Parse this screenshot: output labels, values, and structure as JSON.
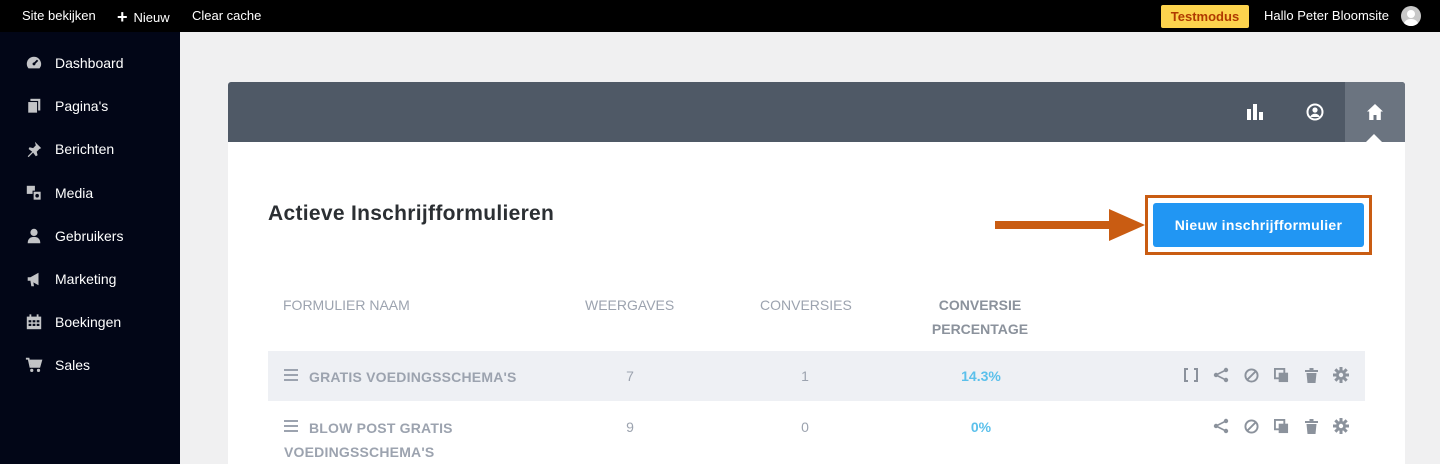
{
  "adminbar": {
    "site_view": "Site bekijken",
    "new_label": "Nieuw",
    "clear_cache": "Clear cache",
    "test_mode": "Testmodus",
    "greeting": "Hallo Peter Bloomsite"
  },
  "sidebar": {
    "items": [
      {
        "label": "Dashboard",
        "icon": "dashboard-icon"
      },
      {
        "label": "Pagina's",
        "icon": "pages-icon"
      },
      {
        "label": "Berichten",
        "icon": "pin-icon"
      },
      {
        "label": "Media",
        "icon": "media-icon"
      },
      {
        "label": "Gebruikers",
        "icon": "user-icon"
      },
      {
        "label": "Marketing",
        "icon": "megaphone-icon"
      },
      {
        "label": "Boekingen",
        "icon": "calendar-icon"
      },
      {
        "label": "Sales",
        "icon": "cart-icon"
      }
    ]
  },
  "panel": {
    "title": "Actieve Inschrijfformulieren",
    "new_button": "Nieuw inschrijfformulier",
    "columns": {
      "name": "FORMULIER NAAM",
      "views": "WEERGAVES",
      "conversions": "CONVERSIES",
      "rate_line1": "CONVERSIE",
      "rate_line2": "PERCENTAGE"
    },
    "rows": [
      {
        "name": "GRATIS VOEDINGSSCHEMA'S",
        "views": "7",
        "conversions": "1",
        "rate": "14.3%"
      },
      {
        "name_line1": "BLOW POST GRATIS",
        "name_line2": "VOEDINGSSCHEMA'S",
        "views": "9",
        "conversions": "0",
        "rate": "0%"
      }
    ]
  },
  "colors": {
    "accent": "#2196f3",
    "highlight_border": "#c95c12",
    "rate": "#5bc0eb",
    "test_mode_bg": "#fcd34d"
  }
}
